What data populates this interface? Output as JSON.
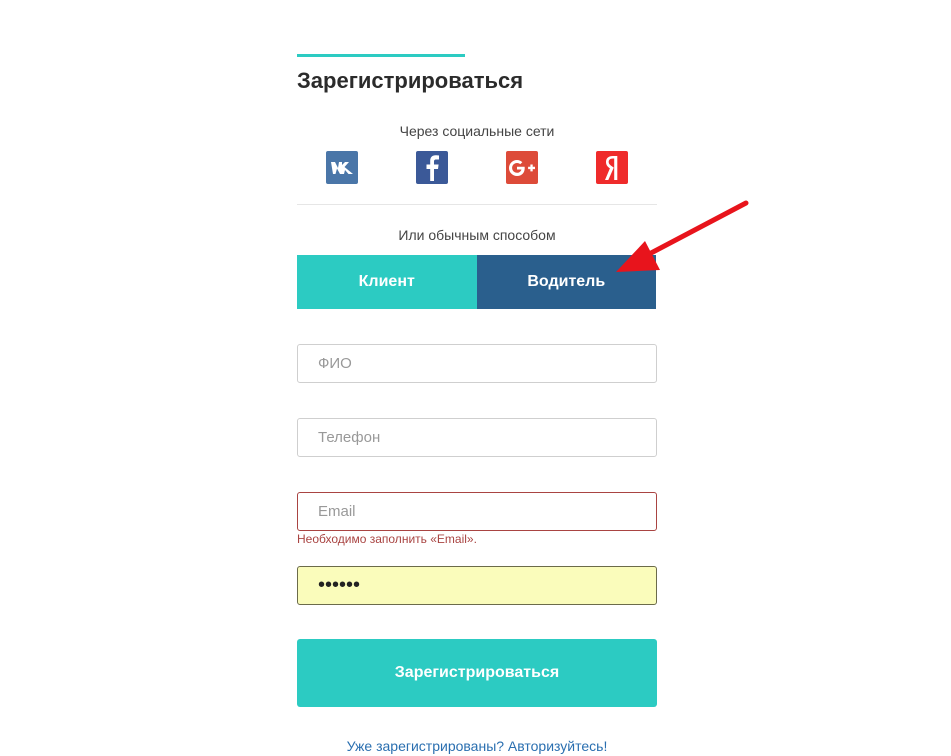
{
  "heading": "Зарегистрироваться",
  "social": {
    "caption": "Через социальные сети",
    "providers": [
      {
        "icon": "vk-icon",
        "glyph": "vk"
      },
      {
        "icon": "facebook-icon",
        "glyph": "f"
      },
      {
        "icon": "google-plus-icon",
        "glyph": "G+"
      },
      {
        "icon": "yandex-icon",
        "glyph": "Я"
      }
    ]
  },
  "alt_caption": "Или обычным способом",
  "role_toggle": {
    "client_label": "Клиент",
    "driver_label": "Водитель",
    "selected": "driver"
  },
  "form": {
    "name_placeholder": "ФИО",
    "name_value": "",
    "phone_placeholder": "Телефон",
    "phone_value": "",
    "email_placeholder": "Email",
    "email_value": "",
    "email_error": "Необходимо заполнить «Email».",
    "password_value": "••••••"
  },
  "submit_label": "Зарегистрироваться",
  "login_link": "Уже зарегистрированы? Авторизуйтесь!",
  "colors": {
    "accent": "#2ccbc2",
    "driver_button": "#2a5f8d",
    "error": "#a94442",
    "link": "#2a6fb0",
    "annotation_arrow": "#e8141c"
  }
}
